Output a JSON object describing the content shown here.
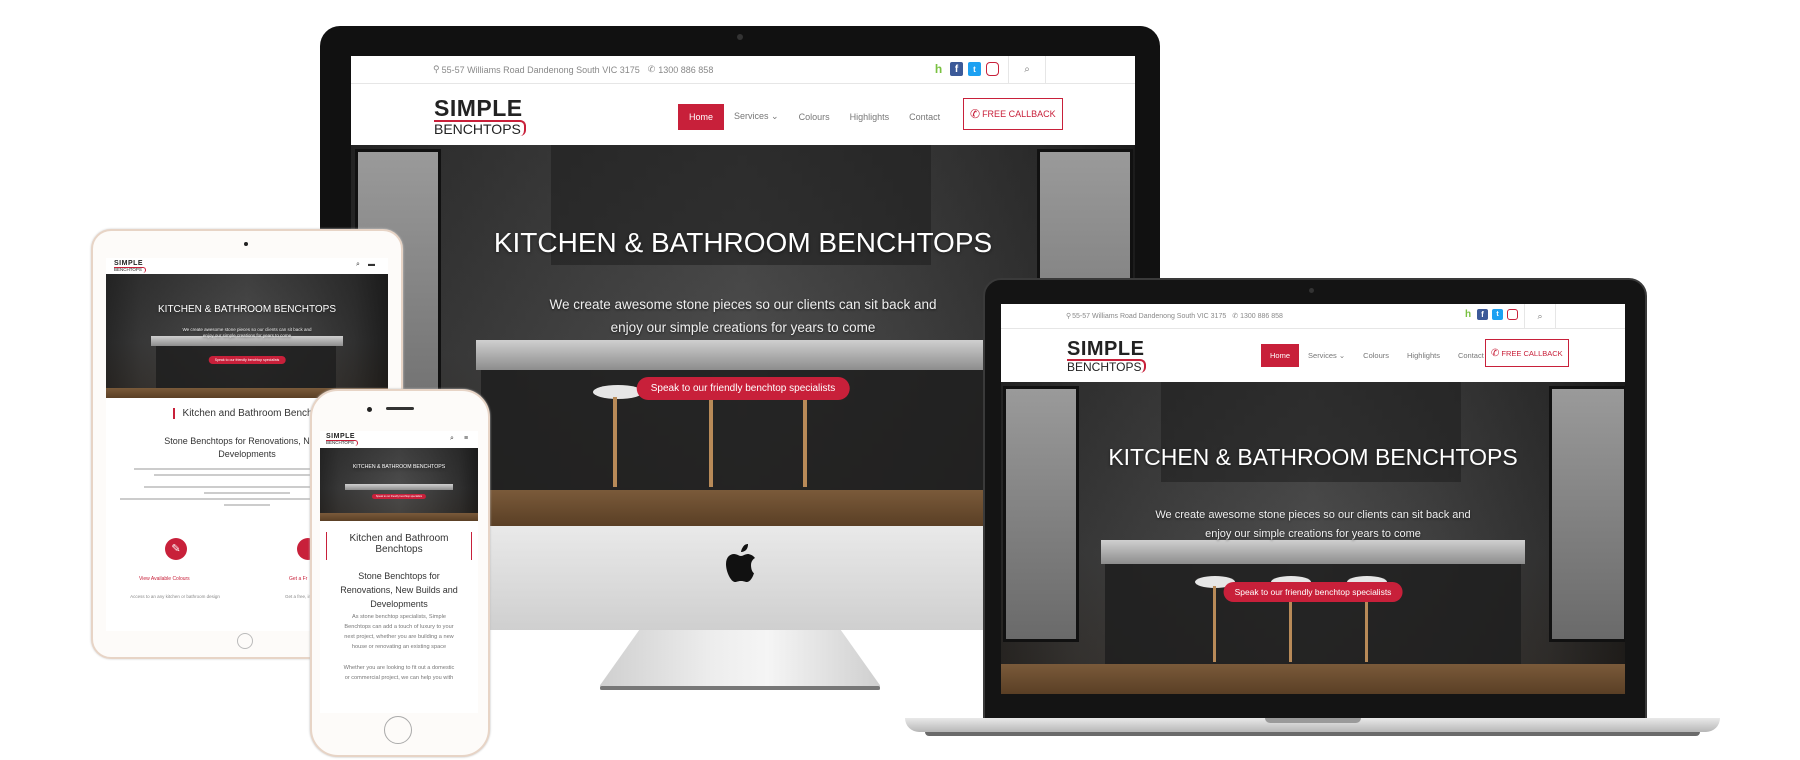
{
  "site": {
    "address": "55-57 Williams Road Dandenong South VIC 3175",
    "phone": "1300 886 858",
    "logo_line1": "SIMPLE",
    "logo_line2": "BENCHTOPS",
    "nav": {
      "home": "Home",
      "services": "Services",
      "colours": "Colours",
      "highlights": "Highlights",
      "contact": "Contact"
    },
    "callback": "FREE CALLBACK",
    "hero_title": "KITCHEN & BATHROOM BENCHTOPS",
    "hero_sub_line1": "We create awesome stone pieces so our clients can sit back and",
    "hero_sub_line2": "enjoy our simple creations for years to come",
    "cta": "Speak to our friendly benchtop specialists",
    "section_title": "Kitchen and Bathroom Benchtops",
    "section_title_short1": "Kitchen and Bathroom",
    "section_title_short2": "Benchtops",
    "tablet_section_title": "Kitchen and Bathroom Benchto",
    "tablet_subheading_line1": "Stone Benchtops for Renovations, New B",
    "tablet_subheading_line2": "Developments",
    "phone_subheading_line1": "Stone Benchtops for",
    "phone_subheading_line2": "Renovations, New Builds and",
    "phone_subheading_line3": "Developments",
    "phone_para1_line1": "As stone benchtop specialists, Simple",
    "phone_para1_line2": "Benchtops can add a touch of luxury to your",
    "phone_para1_line3": "next project, whether you are building a new",
    "phone_para1_line4": "house or renovating an existing space",
    "phone_para2_line1": "Whether you are looking to fit out a domestic",
    "phone_para2_line2": "or commercial project, we can help you with",
    "tablet_link1": "View Available Colours",
    "tablet_link2": "Get a Fr",
    "tablet_feature1": "Access to an any kitchen or bathroom design",
    "tablet_feature2": "Get a free, instant qu"
  },
  "colors": {
    "brand_red": "#c8203a",
    "houzz_green": "#7ac142",
    "facebook_blue": "#3b5998",
    "twitter_blue": "#1da1f2",
    "instagram_red": "#c8203a"
  },
  "icons": [
    "map-marker-icon",
    "phone-icon",
    "houzz-icon",
    "facebook-icon",
    "twitter-icon",
    "instagram-icon",
    "search-icon",
    "callback-phone-icon",
    "cart-icon",
    "hamburger-icon",
    "apple-logo-icon",
    "brush-icon"
  ]
}
